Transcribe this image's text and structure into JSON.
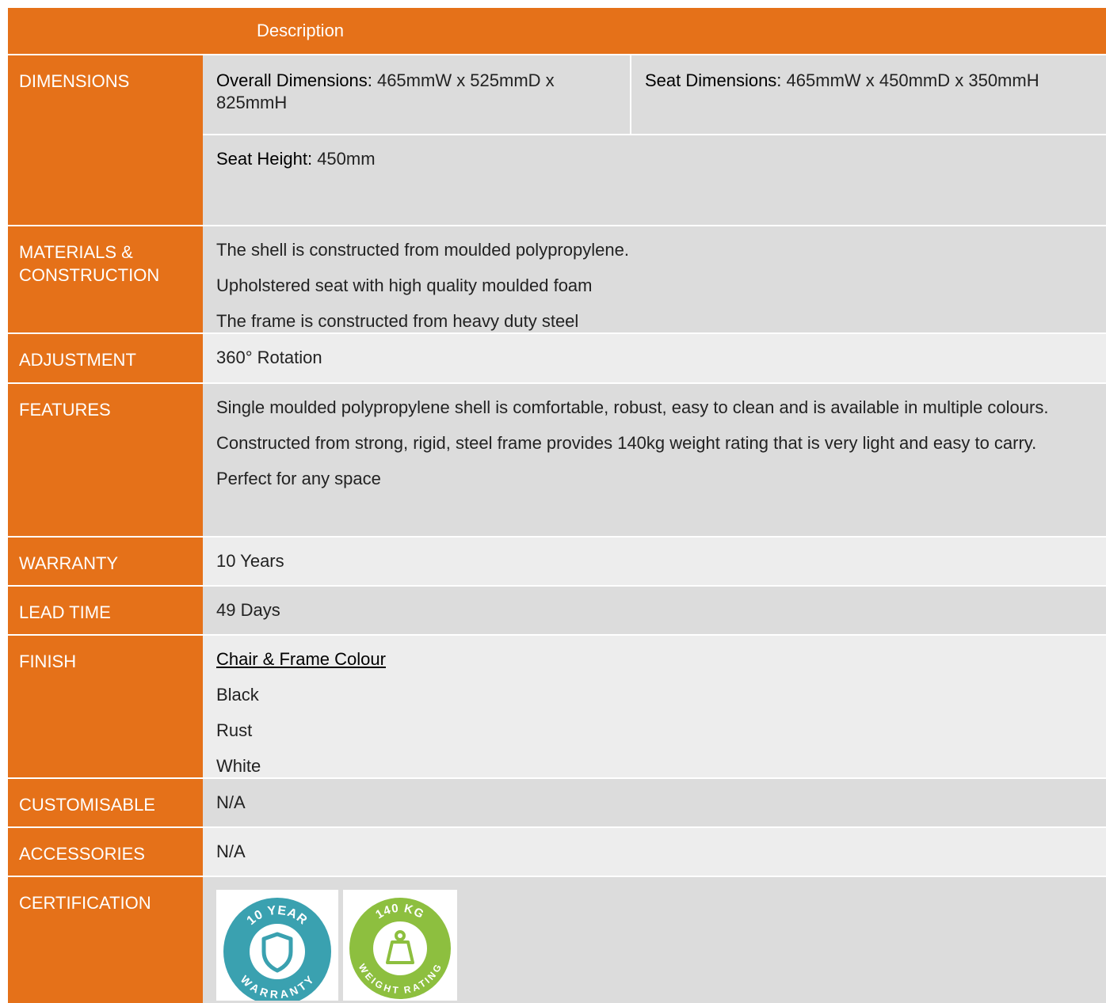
{
  "header": {
    "title": "Description"
  },
  "colors": {
    "accent": "#e57119",
    "row_dark": "#dcdcdc",
    "row_light": "#ededed",
    "warranty_badge": "#3aa1b0",
    "weight_badge": "#8dbf3f"
  },
  "dimensions": {
    "label": "DIMENSIONS",
    "overall_label": "Overall Dimensions:",
    "overall_value": " 465mmW x 525mmD x 825mmH",
    "seat_label": "Seat Dimensions:",
    "seat_value": " 465mmW x 450mmD x 350mmH",
    "height_label": "Seat Height:",
    "height_value": " 450mm"
  },
  "materials": {
    "label": "MATERIALS & CONSTRUCTION",
    "lines": [
      "The shell is constructed from moulded polypropylene.",
      "Upholstered seat with high quality moulded foam",
      "The frame is constructed from heavy duty steel"
    ]
  },
  "adjustment": {
    "label": "ADJUSTMENT",
    "value": "360° Rotation"
  },
  "features": {
    "label": "FEATURES",
    "lines": [
      "Single moulded polypropylene shell is comfortable, robust, easy to clean and is available in multiple colours.",
      "Constructed from strong, rigid, steel frame provides 140kg weight rating that is very light and easy to carry.",
      "Perfect for any space"
    ]
  },
  "warranty": {
    "label": "WARRANTY",
    "value": "10 Years"
  },
  "lead_time": {
    "label": "LEAD TIME",
    "value": "49 Days"
  },
  "finish": {
    "label": "FINISH",
    "heading": "Chair & Frame Colour",
    "colours": [
      "Black",
      "Rust",
      "White"
    ]
  },
  "customisable": {
    "label": "CUSTOMISABLE",
    "value": "N/A"
  },
  "accessories": {
    "label": "ACCESSORIES",
    "value": "N/A"
  },
  "certification": {
    "label": "CERTIFICATION",
    "badge_warranty": {
      "top": "10 YEAR",
      "bottom": "WARRANTY",
      "icon": "shield-icon"
    },
    "badge_weight": {
      "top": "140 KG",
      "bottom": "WEIGHT RATING",
      "icon": "weight-icon"
    }
  }
}
